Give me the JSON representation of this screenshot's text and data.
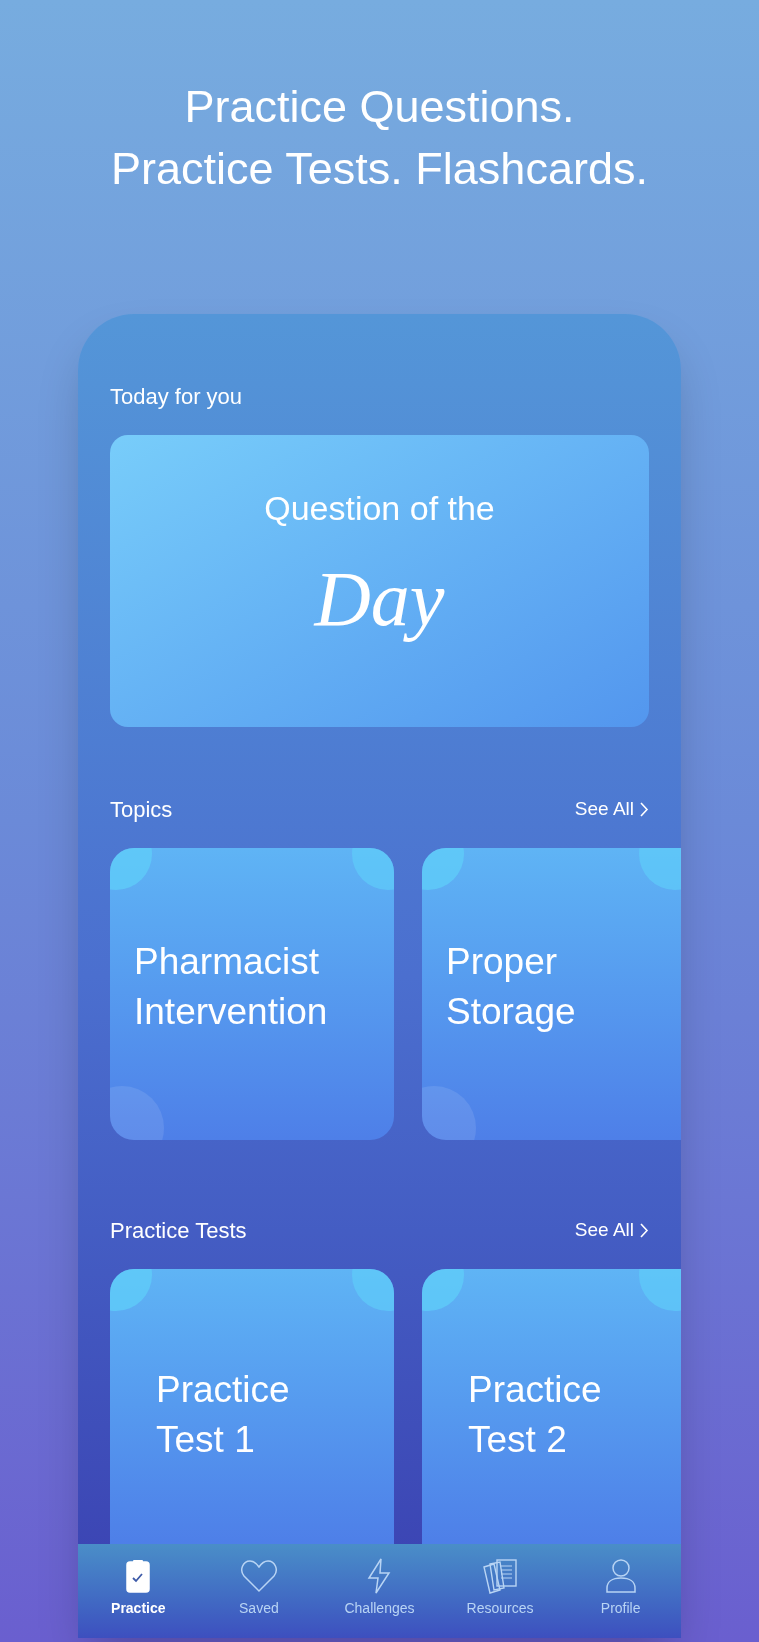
{
  "headline": [
    "Practice Questions.",
    "Practice Tests. Flashcards."
  ],
  "today": {
    "heading": "Today for you",
    "card_line1": "Question of the",
    "card_line2": "Day"
  },
  "sections": [
    {
      "heading": "Topics",
      "see_all": "See All",
      "cards": [
        "Pharmacist Intervention",
        "Proper Storage"
      ]
    },
    {
      "heading": "Practice Tests",
      "see_all": "See All",
      "cards": [
        "Practice Test 1",
        "Practice Test 2"
      ]
    }
  ],
  "tab_bar": [
    {
      "label": "Practice",
      "kind": "clipboard",
      "selected": true
    },
    {
      "label": "Saved",
      "kind": "heart",
      "selected": false
    },
    {
      "label": "Challenges",
      "kind": "bolt",
      "selected": false
    },
    {
      "label": "Resources",
      "kind": "papers",
      "selected": false
    },
    {
      "label": "Profile",
      "kind": "person",
      "selected": false
    }
  ]
}
